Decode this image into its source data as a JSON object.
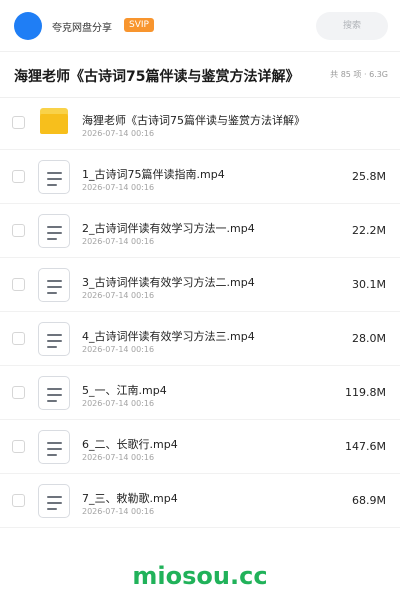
{
  "header": {
    "app_name": "夸克网盘分享",
    "vip_label": "SVIP",
    "search_placeholder": "搜索"
  },
  "folder": {
    "title": "海狸老师《古诗词75篇伴读与鉴赏方法详解》",
    "meta": "共 85 项 · 6.3G"
  },
  "items": [
    {
      "type": "folder",
      "name": "海狸老师《古诗词75篇伴读与鉴赏方法详解》",
      "date": "2026-07-14 00:16",
      "size": ""
    },
    {
      "type": "file",
      "name": "1_古诗词75篇伴读指南.mp4",
      "date": "2026-07-14 00:16",
      "size": "25.8M"
    },
    {
      "type": "file",
      "name": "2_古诗词伴读有效学习方法一.mp4",
      "date": "2026-07-14 00:16",
      "size": "22.2M"
    },
    {
      "type": "file",
      "name": "3_古诗词伴读有效学习方法二.mp4",
      "date": "2026-07-14 00:16",
      "size": "30.1M"
    },
    {
      "type": "file",
      "name": "4_古诗词伴读有效学习方法三.mp4",
      "date": "2026-07-14 00:16",
      "size": "28.0M"
    },
    {
      "type": "file",
      "name": "5_一、江南.mp4",
      "date": "2026-07-14 00:16",
      "size": "119.8M"
    },
    {
      "type": "file",
      "name": "6_二、长歌行.mp4",
      "date": "2026-07-14 00:16",
      "size": "147.6M"
    },
    {
      "type": "file",
      "name": "7_三、敕勒歌.mp4",
      "date": "2026-07-14 00:16",
      "size": "68.9M"
    }
  ],
  "watermark": "miosou.cc",
  "colors": {
    "accent_blue": "#1f7ef5",
    "vip_orange": "#f8952e",
    "folder_yellow": "#f7bf1c",
    "watermark_green": "#21b25a"
  }
}
